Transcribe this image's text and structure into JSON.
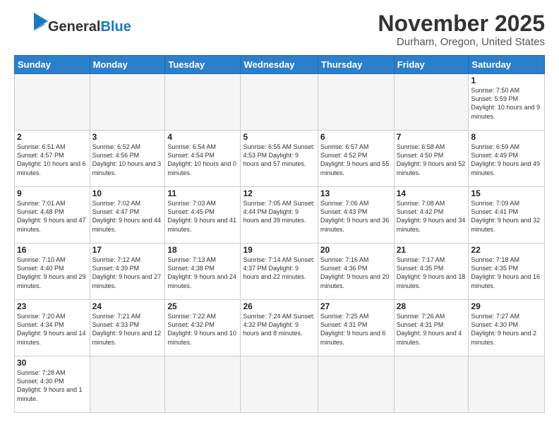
{
  "header": {
    "logo_general": "General",
    "logo_blue": "Blue",
    "month_title": "November 2025",
    "location": "Durham, Oregon, United States"
  },
  "weekdays": [
    "Sunday",
    "Monday",
    "Tuesday",
    "Wednesday",
    "Thursday",
    "Friday",
    "Saturday"
  ],
  "weeks": [
    [
      {
        "day": "",
        "info": ""
      },
      {
        "day": "",
        "info": ""
      },
      {
        "day": "",
        "info": ""
      },
      {
        "day": "",
        "info": ""
      },
      {
        "day": "",
        "info": ""
      },
      {
        "day": "",
        "info": ""
      },
      {
        "day": "1",
        "info": "Sunrise: 7:50 AM\nSunset: 5:59 PM\nDaylight: 10 hours\nand 9 minutes."
      }
    ],
    [
      {
        "day": "2",
        "info": "Sunrise: 6:51 AM\nSunset: 4:57 PM\nDaylight: 10 hours\nand 6 minutes."
      },
      {
        "day": "3",
        "info": "Sunrise: 6:52 AM\nSunset: 4:56 PM\nDaylight: 10 hours\nand 3 minutes."
      },
      {
        "day": "4",
        "info": "Sunrise: 6:54 AM\nSunset: 4:54 PM\nDaylight: 10 hours\nand 0 minutes."
      },
      {
        "day": "5",
        "info": "Sunrise: 6:55 AM\nSunset: 4:53 PM\nDaylight: 9 hours\nand 57 minutes."
      },
      {
        "day": "6",
        "info": "Sunrise: 6:57 AM\nSunset: 4:52 PM\nDaylight: 9 hours\nand 55 minutes."
      },
      {
        "day": "7",
        "info": "Sunrise: 6:58 AM\nSunset: 4:50 PM\nDaylight: 9 hours\nand 52 minutes."
      },
      {
        "day": "8",
        "info": "Sunrise: 6:59 AM\nSunset: 4:49 PM\nDaylight: 9 hours\nand 49 minutes."
      }
    ],
    [
      {
        "day": "9",
        "info": "Sunrise: 7:01 AM\nSunset: 4:48 PM\nDaylight: 9 hours\nand 47 minutes."
      },
      {
        "day": "10",
        "info": "Sunrise: 7:02 AM\nSunset: 4:47 PM\nDaylight: 9 hours\nand 44 minutes."
      },
      {
        "day": "11",
        "info": "Sunrise: 7:03 AM\nSunset: 4:45 PM\nDaylight: 9 hours\nand 41 minutes."
      },
      {
        "day": "12",
        "info": "Sunrise: 7:05 AM\nSunset: 4:44 PM\nDaylight: 9 hours\nand 39 minutes."
      },
      {
        "day": "13",
        "info": "Sunrise: 7:06 AM\nSunset: 4:43 PM\nDaylight: 9 hours\nand 36 minutes."
      },
      {
        "day": "14",
        "info": "Sunrise: 7:08 AM\nSunset: 4:42 PM\nDaylight: 9 hours\nand 34 minutes."
      },
      {
        "day": "15",
        "info": "Sunrise: 7:09 AM\nSunset: 4:41 PM\nDaylight: 9 hours\nand 32 minutes."
      }
    ],
    [
      {
        "day": "16",
        "info": "Sunrise: 7:10 AM\nSunset: 4:40 PM\nDaylight: 9 hours\nand 29 minutes."
      },
      {
        "day": "17",
        "info": "Sunrise: 7:12 AM\nSunset: 4:39 PM\nDaylight: 9 hours\nand 27 minutes."
      },
      {
        "day": "18",
        "info": "Sunrise: 7:13 AM\nSunset: 4:38 PM\nDaylight: 9 hours\nand 24 minutes."
      },
      {
        "day": "19",
        "info": "Sunrise: 7:14 AM\nSunset: 4:37 PM\nDaylight: 9 hours\nand 22 minutes."
      },
      {
        "day": "20",
        "info": "Sunrise: 7:16 AM\nSunset: 4:36 PM\nDaylight: 9 hours\nand 20 minutes."
      },
      {
        "day": "21",
        "info": "Sunrise: 7:17 AM\nSunset: 4:35 PM\nDaylight: 9 hours\nand 18 minutes."
      },
      {
        "day": "22",
        "info": "Sunrise: 7:18 AM\nSunset: 4:35 PM\nDaylight: 9 hours\nand 16 minutes."
      }
    ],
    [
      {
        "day": "23",
        "info": "Sunrise: 7:20 AM\nSunset: 4:34 PM\nDaylight: 9 hours\nand 14 minutes."
      },
      {
        "day": "24",
        "info": "Sunrise: 7:21 AM\nSunset: 4:33 PM\nDaylight: 9 hours\nand 12 minutes."
      },
      {
        "day": "25",
        "info": "Sunrise: 7:22 AM\nSunset: 4:32 PM\nDaylight: 9 hours\nand 10 minutes."
      },
      {
        "day": "26",
        "info": "Sunrise: 7:24 AM\nSunset: 4:32 PM\nDaylight: 9 hours\nand 8 minutes."
      },
      {
        "day": "27",
        "info": "Sunrise: 7:25 AM\nSunset: 4:31 PM\nDaylight: 9 hours\nand 6 minutes."
      },
      {
        "day": "28",
        "info": "Sunrise: 7:26 AM\nSunset: 4:31 PM\nDaylight: 9 hours\nand 4 minutes."
      },
      {
        "day": "29",
        "info": "Sunrise: 7:27 AM\nSunset: 4:30 PM\nDaylight: 9 hours\nand 2 minutes."
      }
    ],
    [
      {
        "day": "30",
        "info": "Sunrise: 7:28 AM\nSunset: 4:30 PM\nDaylight: 9 hours\nand 1 minute."
      },
      {
        "day": "",
        "info": ""
      },
      {
        "day": "",
        "info": ""
      },
      {
        "day": "",
        "info": ""
      },
      {
        "day": "",
        "info": ""
      },
      {
        "day": "",
        "info": ""
      },
      {
        "day": "",
        "info": ""
      }
    ]
  ]
}
